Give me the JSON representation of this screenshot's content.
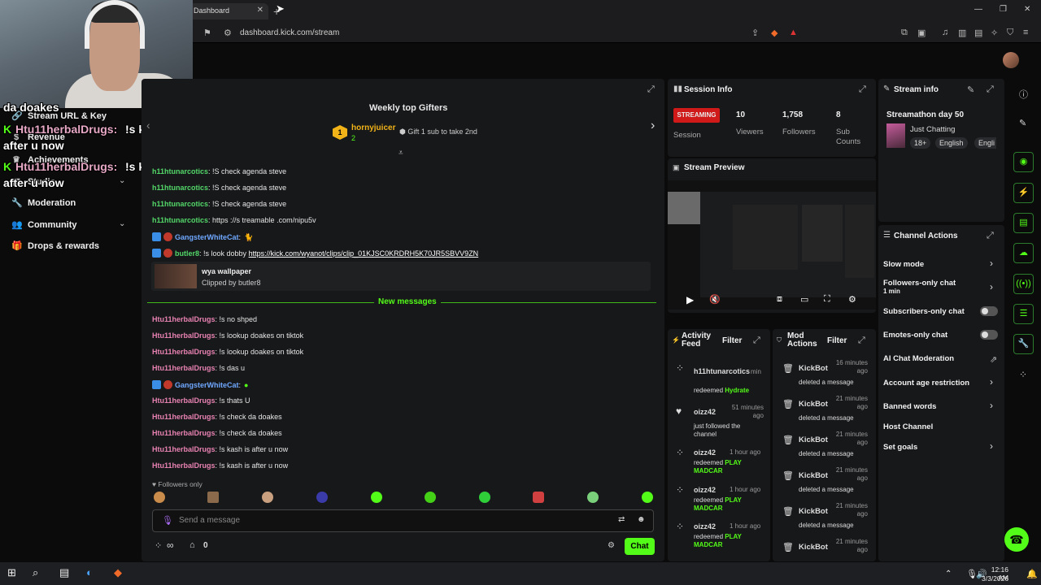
{
  "browser": {
    "tab_title": "Dashboard",
    "url": "dashboard.kick.com/stream"
  },
  "sidebar": {
    "items": [
      {
        "label": "Stream URL & Key",
        "icon": "link-icon"
      },
      {
        "label": "Revenue",
        "icon": "dollar-icon"
      },
      {
        "label": "Achievements",
        "icon": "trophy-icon"
      },
      {
        "label": "Studio",
        "icon": "studio-icon"
      },
      {
        "label": "Moderation",
        "icon": "wrench-icon"
      },
      {
        "label": "Community",
        "icon": "people-icon"
      },
      {
        "label": "Drops & rewards",
        "icon": "gift-icon"
      }
    ]
  },
  "overlay": {
    "line1": "da doakes",
    "name1": "Htu11herbalDrugs:",
    "msg1": "!s kash is",
    "line2": "after u now",
    "name2": "Htu11herbalDrugs:",
    "msg2": "!s kash is",
    "line3": "after u now"
  },
  "chat": {
    "gifters_title": "Weekly top Gifters",
    "top_gifter": "hornyjuicer",
    "top_gifter_rank": "1",
    "top_gifter_count": "2",
    "gift_hint": "Gift 1 sub to take 2nd",
    "messages_old": [
      {
        "user": "h11htunarcotics",
        "text": ": !S check agenda steve"
      },
      {
        "user": "h11htunarcotics",
        "text": ": !S check agenda steve"
      },
      {
        "user": "h11htunarcotics",
        "text": ": !S check agenda steve"
      },
      {
        "user": "h11htunarcotics",
        "text": ": https ://s treamable .com/nipu5v"
      },
      {
        "user": "GangsterWhiteCat",
        "text": ":"
      },
      {
        "user": "butler8",
        "text": ": !s look dobby",
        "link": "https://kick.com/wyanot/clips/clip_01KJSC0KRDRH5K70JR5SBVV9ZN"
      }
    ],
    "clip_title": "wya wallpaper",
    "clip_by": "Clipped by butler8",
    "new_messages": "New messages",
    "messages_new": [
      {
        "user": "Htu11herbalDrugs",
        "text": ": !s no shped"
      },
      {
        "user": "Htu11herbalDrugs",
        "text": ": !s lookup doakes on tiktok"
      },
      {
        "user": "Htu11herbalDrugs",
        "text": ": !s lookup doakes on tiktok"
      },
      {
        "user": "Htu11herbalDrugs",
        "text": ": !s das u"
      },
      {
        "user": "GangsterWhiteCat",
        "text": ":"
      },
      {
        "user": "Htu11herbalDrugs",
        "text": ": !s thats U"
      },
      {
        "user": "Htu11herbalDrugs",
        "text": ": !s check da doakes"
      },
      {
        "user": "Htu11herbalDrugs",
        "text": ": !s check da doakes"
      },
      {
        "user": "Htu11herbalDrugs",
        "text": ": !s kash is after u now"
      },
      {
        "user": "Htu11herbalDrugs",
        "text": ": !s kash is after u now"
      }
    ],
    "followers_only": "Followers only",
    "input_placeholder": "Send a message",
    "infinity": "∞",
    "points": "0",
    "send_label": "Chat"
  },
  "session": {
    "title": "Session Info",
    "status": "STREAMING",
    "session_label": "Session",
    "viewers": "10",
    "viewers_label": "Viewers",
    "followers": "1,758",
    "followers_label": "Followers",
    "subs": "8",
    "subs_label": "Sub Counts"
  },
  "preview": {
    "title": "Stream Preview"
  },
  "activity": {
    "title": "Activity Feed",
    "filter": "Filter",
    "items": [
      {
        "user": "h11htunarcotics",
        "time": "min",
        "action": "redeemed",
        "reward": "Hydrate"
      },
      {
        "user": "oizz42",
        "time": "51 minutes ago",
        "action": "just followed the channel",
        "reward": ""
      },
      {
        "user": "oizz42",
        "time": "1 hour ago",
        "action": "redeemed",
        "reward": "PLAY MADCAR"
      },
      {
        "user": "oizz42",
        "time": "1 hour ago",
        "action": "redeemed",
        "reward": "PLAY MADCAR"
      },
      {
        "user": "oizz42",
        "time": "1 hour ago",
        "action": "redeemed",
        "reward": "PLAY MADCAR"
      }
    ]
  },
  "mod": {
    "title": "Mod Actions",
    "filter": "Filter",
    "items": [
      {
        "user": "KickBot",
        "time": "16 minutes ago",
        "action": "deleted a message"
      },
      {
        "user": "KickBot",
        "time": "21 minutes ago",
        "action": "deleted a message"
      },
      {
        "user": "KickBot",
        "time": "21 minutes ago",
        "action": "deleted a message"
      },
      {
        "user": "KickBot",
        "time": "21 minutes ago",
        "action": "deleted a message"
      },
      {
        "user": "KickBot",
        "time": "21 minutes ago",
        "action": "deleted a message"
      },
      {
        "user": "KickBot",
        "time": "21 minutes ago",
        "action": ""
      }
    ]
  },
  "stream_info": {
    "title": "Stream info",
    "stream_title": "Streamathon day 50",
    "category": "Just Chatting",
    "tags": [
      "18+",
      "English",
      "Engli"
    ]
  },
  "channel_actions": {
    "title": "Channel Actions",
    "slow_mode": "Slow mode",
    "followers_only": "Followers-only chat",
    "followers_only_sub": "1 min",
    "subscribers_only": "Subscribers-only chat",
    "emotes_only": "Emotes-only chat",
    "ai_moderation": "AI Chat Moderation",
    "account_age": "Account age restriction",
    "banned_words": "Banned words",
    "host_channel": "Host Channel",
    "set_goals": "Set goals"
  },
  "taskbar": {
    "time": "12:16 AM",
    "date": "3/3/2026"
  },
  "colors": {
    "accent": "#53fc18",
    "streaming": "#d01919",
    "panel": "#17181a"
  }
}
